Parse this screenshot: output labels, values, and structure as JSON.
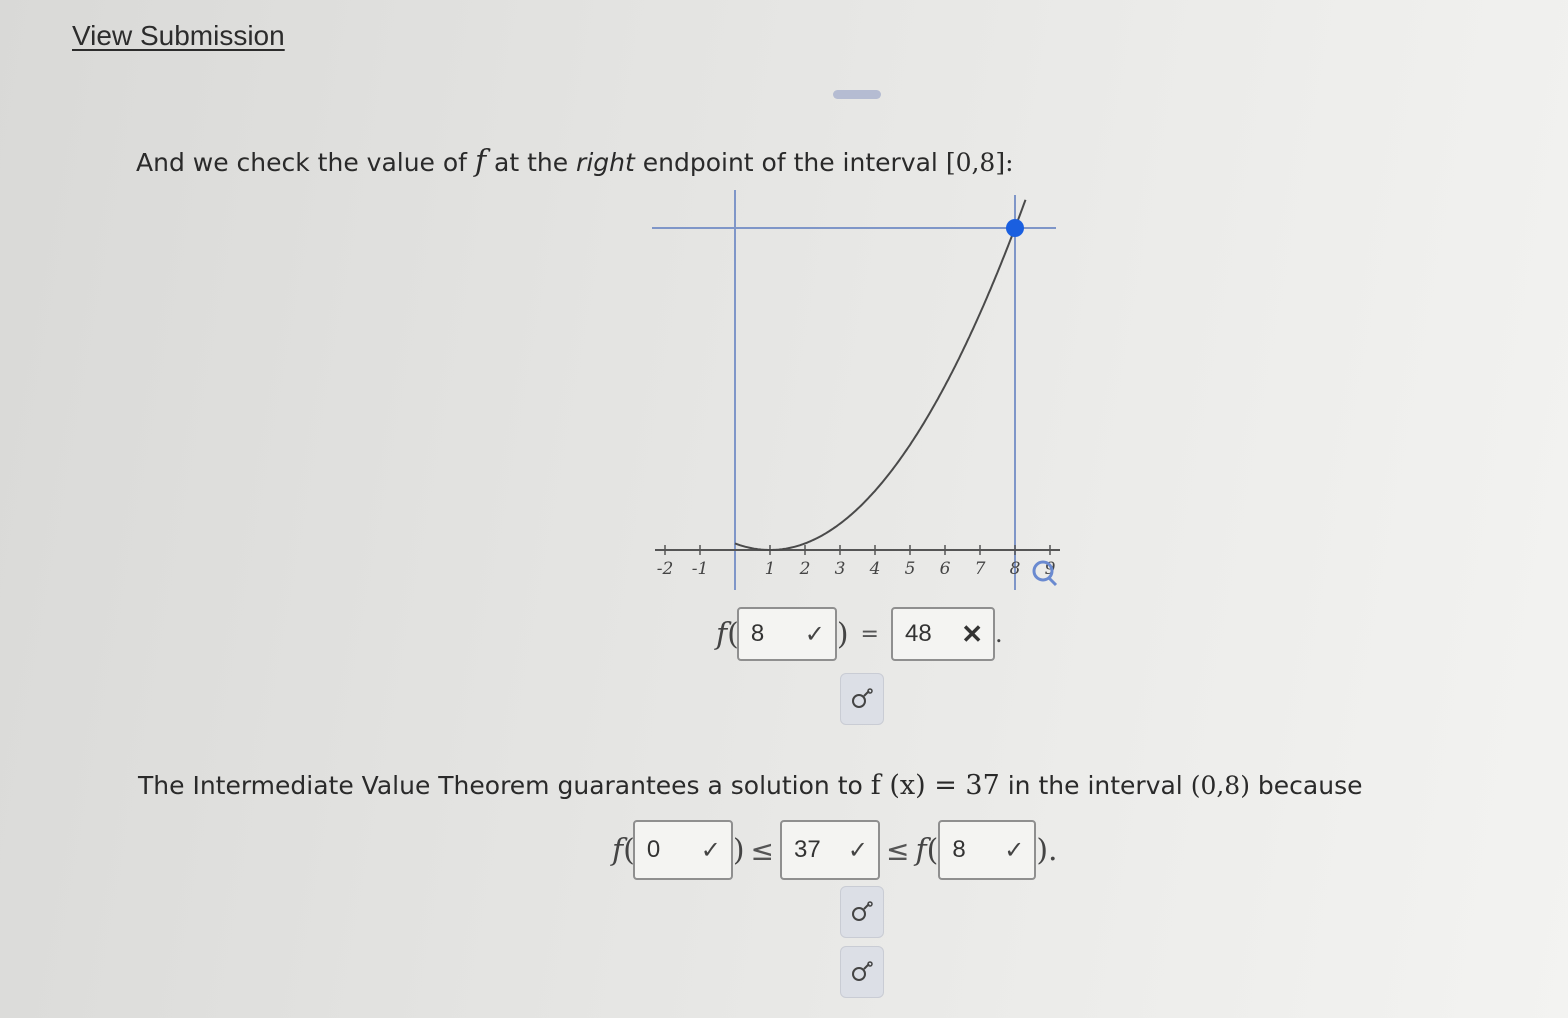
{
  "header": {
    "view_submission": "View Submission"
  },
  "part1": {
    "text_a": "And we check the value of ",
    "f": "f",
    "text_b": " at the ",
    "right": "right",
    "text_c": " endpoint of the interval ",
    "interval": "[0,8]:"
  },
  "graph": {
    "x_ticks": [
      "-2",
      "-1",
      "1",
      "2",
      "3",
      "4",
      "5",
      "6",
      "7",
      "8",
      "9"
    ],
    "highlight_point": {
      "x": 8,
      "y": 48
    },
    "magnifier_icon": "magnifier-icon"
  },
  "answer1": {
    "f": "f",
    "open": "(",
    "input_value": "8",
    "close": ")",
    "equals": "=",
    "result_value": "48",
    "period": ".",
    "input_mark": "✓",
    "result_mark": "✕"
  },
  "part2": {
    "text_a": "The Intermediate Value Theorem guarantees a solution to ",
    "expr": "f (x) = 37",
    "text_b": " in the interval ",
    "interval": "(0,8)",
    "text_c": " because"
  },
  "answer2": {
    "f1": "f",
    "open1": "(",
    "val1": "0",
    "close1": ")",
    "leq1": "≤",
    "val2": "37",
    "leq2": "≤",
    "f2": "f",
    "open2": "(",
    "val3": "8",
    "close2": ").",
    "mark": "✓"
  },
  "icons": {
    "keypad": "keypad-icon"
  },
  "colors": {
    "point": "#1a5fe0",
    "curve": "#4a4a4a",
    "gridline": "#7f96c8"
  }
}
